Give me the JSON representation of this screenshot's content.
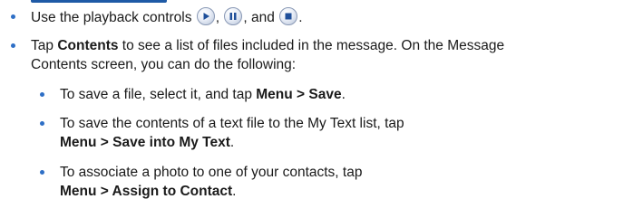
{
  "bullets": [
    {
      "text_before": "Use the playback controls",
      "icons": [
        "play-icon",
        "pause-icon",
        "stop-icon"
      ],
      "sep1": ",",
      "sep2": ", and",
      "end": "."
    },
    {
      "prefix": "Tap",
      "bold": "Contents",
      "line1_rest": "to see a list of files included in the message. On the Message",
      "line2": "Contents screen, you can do the following:"
    }
  ],
  "sub_bullets": [
    {
      "text": "To save a file, select it, and tap",
      "bold": "Menu > Save",
      "end": "."
    },
    {
      "text": "To save the contents of a text file to the My Text list, tap",
      "bold": "Menu > Save into My Text",
      "end": "."
    },
    {
      "text": "To associate a photo to one of your contacts, tap",
      "bold": "Menu > Assign to Contact",
      "end": "."
    }
  ]
}
